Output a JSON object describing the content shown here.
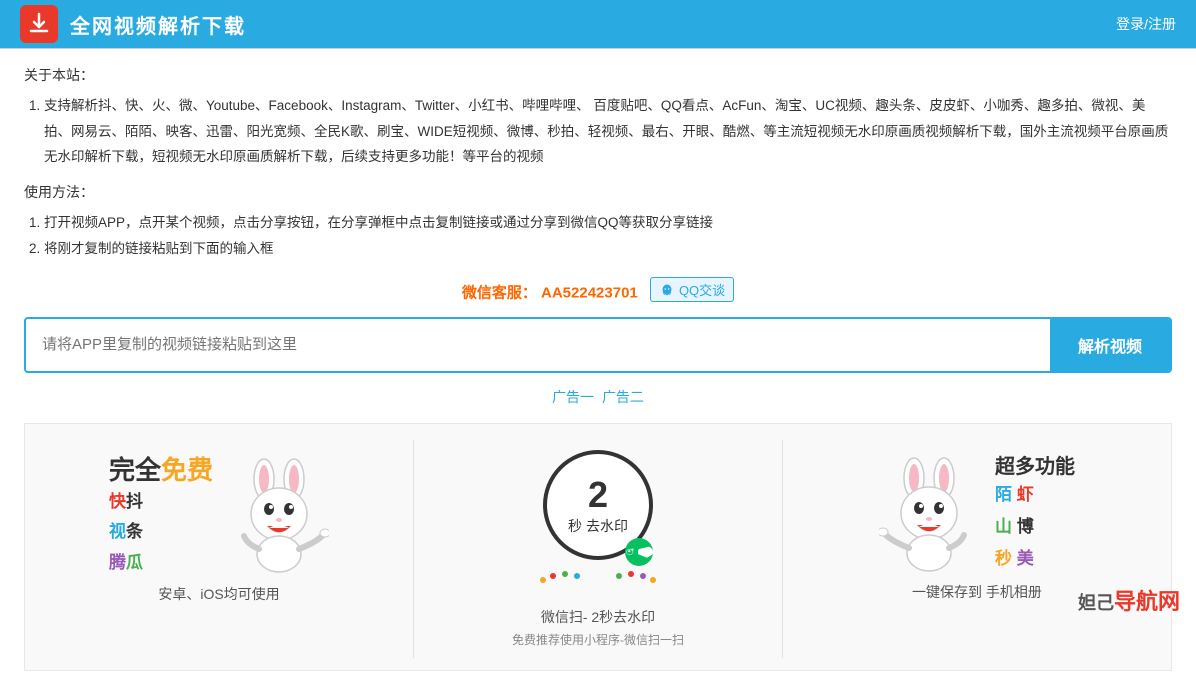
{
  "header": {
    "title": "全网视频解析下载",
    "login_label": "登录/注册"
  },
  "about": {
    "section_title": "关于本站：",
    "support_text": "支持解析抖、快、火、微、Youtube、Facebook、Instagram、Twitter、小红书、哔哩哔哩、 百度贴吧、QQ看点、AcFun、淘宝、UC视频、趣头条、皮皮虾、小咖秀、趣多拍、微视、美拍、网易云、陌陌、映客、迅雷、阳光宽频、全民K歌、刷宝、WIDE短视频、微博、秒拍、轻视频、最右、开眼、酷燃、等主流短视频无水印原画质视频解析下载，国外主流视频平台原画质无水印解析下载，短视频无水印原画质解析下载，后续支持更多功能！等平台的视频"
  },
  "usage": {
    "section_title": "使用方法：",
    "step1": "打开视频APP，点开某个视频，点击分享按钮，在分享弹框中点击复制链接或通过分享到微信QQ等获取分享链接",
    "step2": "将刚才复制的链接粘贴到下面的输入框"
  },
  "contact": {
    "label": "微信客服：",
    "wechat_id": "AA522423701",
    "qq_btn_label": "QQ交谈"
  },
  "search": {
    "placeholder": "请将APP里复制的视频链接粘贴到这里",
    "btn_label": "解析视频"
  },
  "ads": {
    "ad1": "广告一",
    "ad2": "广告二"
  },
  "banners": {
    "left": {
      "free_label": "完全",
      "free_highlight": "免费",
      "platforms": [
        "快抖",
        "视条",
        "腾瓜"
      ],
      "caption": "安卓、iOS均可使用"
    },
    "middle": {
      "seconds": "2",
      "sec_label": "秒",
      "action": "去水印",
      "caption": "微信扫- 2秒去水印",
      "sub": "免费推荐使用小程序-微信扫一扫"
    },
    "right": {
      "header": "超多功能",
      "platforms": [
        "陌 虾",
        "山 博",
        "秒 美"
      ],
      "caption": "一键保存到 手机相册"
    }
  },
  "site_watermark": "妲己导航网"
}
